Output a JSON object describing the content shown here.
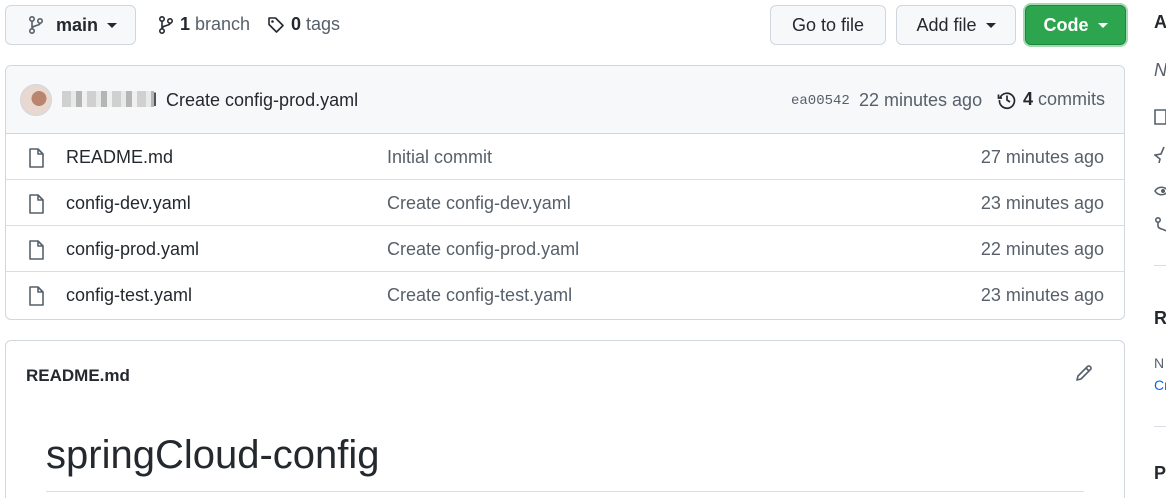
{
  "branch": {
    "name": "main"
  },
  "meta": {
    "branch_count": "1",
    "branch_label": "branch",
    "tag_count": "0",
    "tag_label": "tags"
  },
  "actions": {
    "go_to_file": "Go to file",
    "add_file": "Add file",
    "code": "Code"
  },
  "latest_commit": {
    "author_visible_tail": "l",
    "message": "Create config-prod.yaml",
    "sha": "ea00542",
    "age": "22 minutes ago",
    "commit_count": "4",
    "commits_label": "commits"
  },
  "files": [
    {
      "name": "README.md",
      "message": "Initial commit",
      "age": "27 minutes ago"
    },
    {
      "name": "config-dev.yaml",
      "message": "Create config-dev.yaml",
      "age": "23 minutes ago"
    },
    {
      "name": "config-prod.yaml",
      "message": "Create config-prod.yaml",
      "age": "22 minutes ago"
    },
    {
      "name": "config-test.yaml",
      "message": "Create config-test.yaml",
      "age": "23 minutes ago"
    }
  ],
  "readme": {
    "filename": "README.md",
    "heading": "springCloud-config"
  },
  "sidebar": {
    "about_initial": "A",
    "desc_initial": "N",
    "releases_initial": "R",
    "no_initial": "N",
    "create_initial": "Cr",
    "packages_initial": "P"
  },
  "colors": {
    "primary_button": "#2da44e",
    "border": "#d0d7de",
    "muted_text": "#57606a",
    "link": "#0969da"
  }
}
